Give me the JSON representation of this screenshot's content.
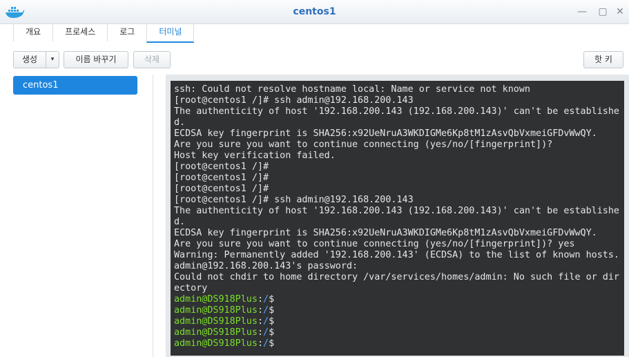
{
  "window": {
    "title": "centos1",
    "controls": {
      "minimize": "—",
      "maximize": "▢",
      "close": "✕"
    },
    "app_icon": "docker-whale-icon"
  },
  "tabs": [
    {
      "label": "개요",
      "active": false
    },
    {
      "label": "프로세스",
      "active": false
    },
    {
      "label": "로그",
      "active": false
    },
    {
      "label": "터미널",
      "active": true
    }
  ],
  "toolbar": {
    "create_label": "생성",
    "dropdown_label": "▾",
    "rename_label": "이름 바꾸기",
    "delete_label": "삭제",
    "hotkey_label": "핫 키"
  },
  "sidebar": {
    "items": [
      {
        "label": "centos1",
        "selected": true
      }
    ]
  },
  "terminal": {
    "lines": [
      "ssh: Could not resolve hostname local: Name or service not known",
      "[root@centos1 /]# ssh admin@192.168.200.143",
      "The authenticity of host '192.168.200.143 (192.168.200.143)' can't be establishe",
      "d.",
      "ECDSA key fingerprint is SHA256:x92UeNruA3WKDIGMe6Kp8tM1zAsvQbVxmeiGFDvWwQY.",
      "Are you sure you want to continue connecting (yes/no/[fingerprint])?",
      "Host key verification failed.",
      "[root@centos1 /]#",
      "[root@centos1 /]#",
      "[root@centos1 /]#",
      "[root@centos1 /]# ssh admin@192.168.200.143",
      "The authenticity of host '192.168.200.143 (192.168.200.143)' can't be establishe",
      "d.",
      "ECDSA key fingerprint is SHA256:x92UeNruA3WKDIGMe6Kp8tM1zAsvQbVxmeiGFDvWwQY.",
      "Are you sure you want to continue connecting (yes/no/[fingerprint])? yes",
      "Warning: Permanently added '192.168.200.143' (ECDSA) to the list of known hosts.",
      "admin@192.168.200.143's password:",
      "Could not chdir to home directory /var/services/homes/admin: No such file or dir",
      "ectory"
    ],
    "prompt_user": "admin@DS918Plus",
    "prompt_sep": ":",
    "prompt_path": "/",
    "prompt_end": "$",
    "prompt_count": 5,
    "colors": {
      "background": "#2f3133",
      "text": "#e6e6e6",
      "user": "#7ddf2b",
      "path": "#4da7ff"
    }
  }
}
